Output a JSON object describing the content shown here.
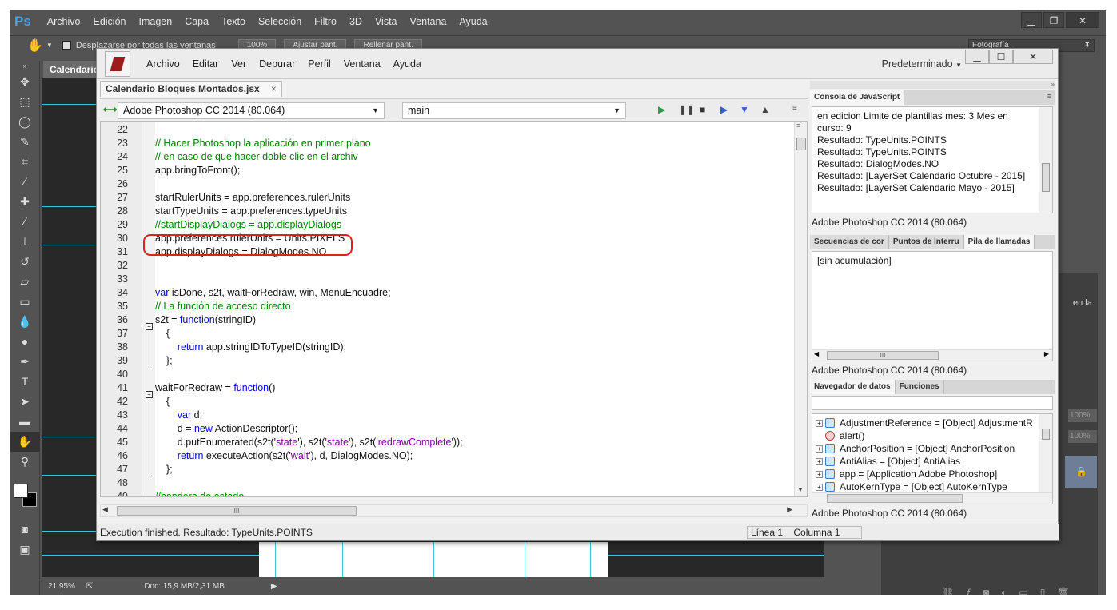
{
  "ps": {
    "logo": "Ps",
    "menu": [
      "Archivo",
      "Edición",
      "Imagen",
      "Capa",
      "Texto",
      "Selección",
      "Filtro",
      "3D",
      "Vista",
      "Ventana",
      "Ayuda"
    ],
    "options": {
      "scroll_all": "Desplazarse por todas las ventanas",
      "zoom": "100%",
      "fit": "Ajustar pant.",
      "fill": "Rellenar pant.",
      "workspace": "Fotografía"
    },
    "doc_tab": "Calendario",
    "status_zoom": "21,95%",
    "status_doc": "Doc: 15,9 MB/2,31 MB",
    "right_text": "en la",
    "pct1": "100%",
    "pct2": "100%"
  },
  "estk": {
    "menu": [
      "Archivo",
      "Editar",
      "Ver",
      "Depurar",
      "Perfil",
      "Ventana",
      "Ayuda"
    ],
    "preset": "Predeterminado",
    "file_tab": "Calendario Bloques Montados.jsx",
    "target": "Adobe Photoshop CC 2014 (80.064)",
    "engine": "main",
    "code_lines": [
      {
        "n": "22",
        "t": ""
      },
      {
        "n": "23",
        "t": "// Hacer Photoshop la aplicación en primer plano"
      },
      {
        "n": "24",
        "t": "// en caso de que hacer doble clic en el archiv"
      },
      {
        "n": "25",
        "t": "app.bringToFront();"
      },
      {
        "n": "26",
        "t": ""
      },
      {
        "n": "27",
        "t": "startRulerUnits = app.preferences.rulerUnits"
      },
      {
        "n": "28",
        "t": "startTypeUnits = app.preferences.typeUnits"
      },
      {
        "n": "29",
        "t": "//startDisplayDialogs = app.displayDialogs"
      },
      {
        "n": "30",
        "t": "app.preferences.rulerUnits = Units.PIXELS"
      },
      {
        "n": "31",
        "t": "app.displayDialogs = DialogModes.NO"
      },
      {
        "n": "32",
        "t": ""
      },
      {
        "n": "33",
        "t": ""
      },
      {
        "n": "34",
        "t": "var isDone, s2t, waitForRedraw, win, MenuEncuadre;"
      },
      {
        "n": "35",
        "t": "// La función de acceso directo"
      },
      {
        "n": "36",
        "t": "s2t = function(stringID)"
      },
      {
        "n": "37",
        "t": "    {"
      },
      {
        "n": "38",
        "t": "        return app.stringIDToTypeID(stringID);"
      },
      {
        "n": "39",
        "t": "    };"
      },
      {
        "n": "40",
        "t": ""
      },
      {
        "n": "41",
        "t": "waitForRedraw = function()"
      },
      {
        "n": "42",
        "t": "    {"
      },
      {
        "n": "43",
        "t": "        var d;"
      },
      {
        "n": "44",
        "t": "        d = new ActionDescriptor();"
      },
      {
        "n": "45",
        "t": "        d.putEnumerated(s2t('state'), s2t('state'), s2t('redrawComplete'));"
      },
      {
        "n": "46",
        "t": "        return executeAction(s2t('wait'), d, DialogModes.NO);"
      },
      {
        "n": "47",
        "t": "    };"
      },
      {
        "n": "48",
        "t": ""
      },
      {
        "n": "49",
        "t": "//bandera de estado"
      }
    ],
    "console": {
      "title": "Consola de JavaScript",
      "lines": [
        "en edicion Limite de plantillas mes:  3    Mes en",
        "curso:  9",
        "Resultado: TypeUnits.POINTS",
        "Resultado: TypeUnits.POINTS",
        "Resultado: DialogModes.NO",
        "Resultado: [LayerSet Calendario   Octubre - 2015]",
        "Resultado: [LayerSet Calendario   Mayo - 2015]"
      ],
      "footer": "Adobe Photoshop CC 2014 (80.064)"
    },
    "callstack": {
      "tabs": [
        "Secuencias de cor",
        "Puntos de interru",
        "Pila de llamadas"
      ],
      "text": "[sin acumulación]",
      "footer": "Adobe Photoshop CC 2014 (80.064)"
    },
    "datanav": {
      "tabs": [
        "Navegador de datos",
        "Funciones"
      ],
      "rows": [
        {
          "type": "obj",
          "text": "AdjustmentReference = [Object] AdjustmentR"
        },
        {
          "type": "fn",
          "text": "alert()"
        },
        {
          "type": "obj",
          "text": "AnchorPosition = [Object] AnchorPosition"
        },
        {
          "type": "obj",
          "text": "AntiAlias = [Object] AntiAlias"
        },
        {
          "type": "obj",
          "text": "app = [Application Adobe Photoshop]"
        },
        {
          "type": "obj",
          "text": "AutoKernType = [Object] AutoKernType"
        }
      ],
      "footer": "Adobe Photoshop CC 2014 (80.064)"
    },
    "status": "Execution finished. Resultado: TypeUnits.POINTS",
    "line_label": "Línea 1",
    "col_label": "Columna 1",
    "scroll_grip": "III"
  }
}
